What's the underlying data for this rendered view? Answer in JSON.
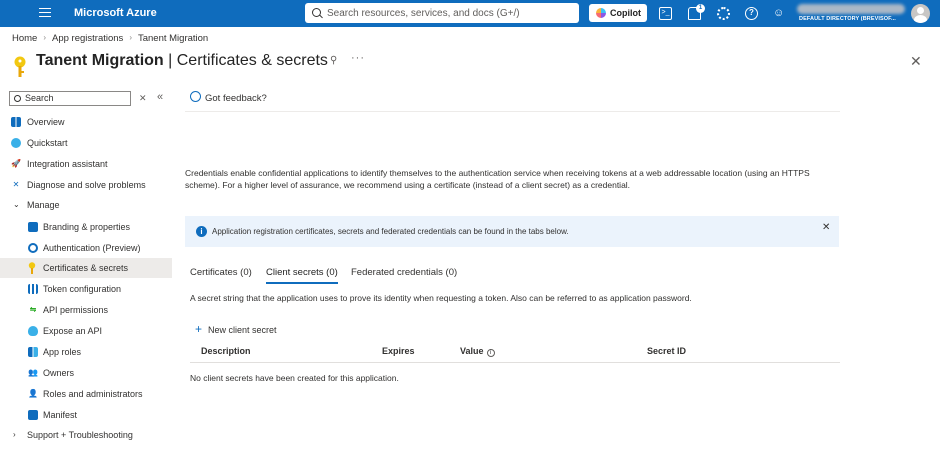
{
  "topbar": {
    "brand": "Microsoft Azure",
    "search_placeholder": "Search resources, services, and docs (G+/)",
    "copilot_label": "Copilot",
    "notification_count": "1",
    "directory": "DEFAULT DIRECTORY (BREVISOF..."
  },
  "breadcrumb": [
    "Home",
    "App registrations",
    "Tanent Migration"
  ],
  "page": {
    "title_resource": "Tanent Migration",
    "title_separator": " | ",
    "title_blade": "Certificates & secrets"
  },
  "sidebar": {
    "search_value": "Search",
    "items": [
      {
        "label": "Overview"
      },
      {
        "label": "Quickstart"
      },
      {
        "label": "Integration assistant"
      },
      {
        "label": "Diagnose and solve problems"
      },
      {
        "label": "Manage"
      },
      {
        "label": "Branding & properties"
      },
      {
        "label": "Authentication (Preview)"
      },
      {
        "label": "Certificates & secrets"
      },
      {
        "label": "Token configuration"
      },
      {
        "label": "API permissions"
      },
      {
        "label": "Expose an API"
      },
      {
        "label": "App roles"
      },
      {
        "label": "Owners"
      },
      {
        "label": "Roles and administrators"
      },
      {
        "label": "Manifest"
      },
      {
        "label": "Support + Troubleshooting"
      }
    ]
  },
  "content": {
    "feedback": "Got feedback?",
    "description": "Credentials enable confidential applications to identify themselves to the authentication service when receiving tokens at a web addressable location (using an HTTPS scheme). For a higher level of assurance, we recommend using a certificate (instead of a client secret) as a credential.",
    "info_banner": "Application registration certificates, secrets and federated credentials can be found in the tabs below.",
    "tabs": [
      "Certificates (0)",
      "Client secrets (0)",
      "Federated credentials (0)"
    ],
    "secret_description": "A secret string that the application uses to prove its identity when requesting a token. Also can be referred to as application password.",
    "new_secret_label": "New client secret",
    "table": {
      "headers": [
        "Description",
        "Expires",
        "Value",
        "Secret ID"
      ],
      "empty_message": "No client secrets have been created for this application."
    }
  }
}
